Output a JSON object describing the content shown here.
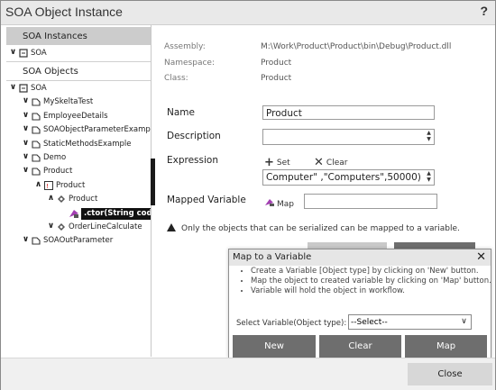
{
  "window": {
    "title": "SOA Object Instance",
    "help": "?"
  },
  "left": {
    "instances_header": "SOA Instances",
    "instances": [
      {
        "label": "SOA",
        "expander": "expanded"
      }
    ],
    "objects_label": "SOA Objects",
    "tree": [
      {
        "label": "SOA",
        "depth": 0,
        "expander": "expanded",
        "icon": "namespace-icon"
      },
      {
        "label": "MySkeltaTest",
        "depth": 1,
        "expander": "expanded",
        "icon": "class-icon"
      },
      {
        "label": "EmployeeDetails",
        "depth": 1,
        "expander": "expanded",
        "icon": "class-icon"
      },
      {
        "label": "SOAObjectParameterExample",
        "depth": 1,
        "expander": "expanded",
        "icon": "class-icon"
      },
      {
        "label": "StaticMethodsExample",
        "depth": 1,
        "expander": "expanded",
        "icon": "class-icon"
      },
      {
        "label": "Demo",
        "depth": 1,
        "expander": "expanded",
        "icon": "class-icon"
      },
      {
        "label": "Product",
        "depth": 1,
        "expander": "expanded",
        "icon": "class-icon"
      },
      {
        "label": "Product",
        "depth": 2,
        "expander": "collapsed",
        "icon": "object-icon"
      },
      {
        "label": "Product",
        "depth": 3,
        "expander": "collapsed",
        "icon": "constructor-group-icon"
      },
      {
        "label": ".ctor(String code)",
        "depth": 4,
        "expander": "none",
        "icon": "method-icon",
        "selected": true
      },
      {
        "label": "OrderLineCalculate",
        "depth": 3,
        "expander": "expanded",
        "icon": "constructor-group-icon"
      },
      {
        "label": "SOAOutParameter",
        "depth": 1,
        "expander": "expanded",
        "icon": "class-icon"
      }
    ]
  },
  "info": {
    "assembly_label": "Assembly:",
    "assembly_value": "M:\\Work\\Product\\Product\\bin\\Debug\\Product.dll",
    "namespace_label": "Namespace:",
    "namespace_value": "Product",
    "class_label": "Class:",
    "class_value": "Product"
  },
  "form": {
    "name_label": "Name",
    "name_value": "Product",
    "description_label": "Description",
    "description_value": "",
    "expression_label": "Expression",
    "set_label": "Set",
    "clear_label": "Clear",
    "expression_value": "Computer\" ,\"Computers\",50000)",
    "mapped_label": "Mapped Variable",
    "map_label": "Map",
    "mapped_value": "",
    "note": "Only the objects that can be serialized can be mapped to a variable."
  },
  "popup": {
    "title": "Map to a Variable",
    "close": "✕",
    "bullets": [
      "Create a Variable [Object type] by clicking on 'New' button.",
      "Map the object to created variable by clicking on 'Map' button.",
      "Variable will hold the object in workflow."
    ],
    "select_label": "Select Variable(Object type):",
    "select_value": "--Select--",
    "new_label": "New",
    "clear_label": "Clear",
    "map_label": "Map"
  },
  "footer": {
    "close_label": "Close"
  },
  "colors": {
    "header_gray": "#cccccc",
    "selection": "#111111",
    "popup_button": "#6e6e6e",
    "close_button": "#d7d7d7"
  }
}
